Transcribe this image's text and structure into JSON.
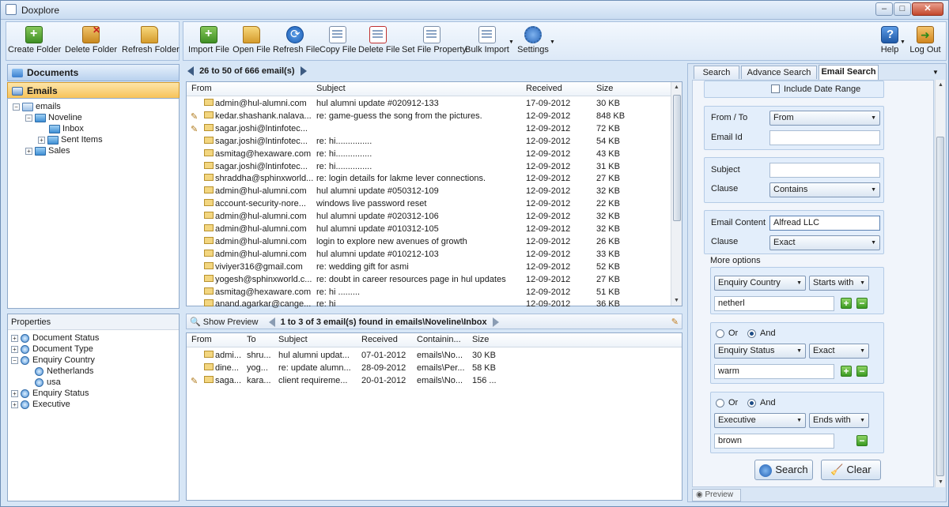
{
  "window": {
    "title": "Doxplore",
    "min": "–",
    "max": "□",
    "close": "✕"
  },
  "left_toolbar": [
    {
      "label": "Create Folder",
      "icon": "create-folder-icon"
    },
    {
      "label": "Delete Folder",
      "icon": "delete-folder-icon"
    },
    {
      "label": "Refresh Folder",
      "icon": "refresh-folder-icon"
    }
  ],
  "main_toolbar": [
    {
      "label": "Import File",
      "icon": "import-file-icon"
    },
    {
      "label": "Open File",
      "icon": "open-file-icon"
    },
    {
      "label": "Refresh File",
      "icon": "refresh-file-icon"
    },
    {
      "label": "Copy File",
      "icon": "copy-file-icon"
    },
    {
      "label": "Delete File",
      "icon": "delete-file-icon"
    },
    {
      "label": "Set File Property",
      "icon": "set-file-property-icon"
    },
    {
      "label": "Bulk Import",
      "icon": "bulk-import-icon"
    },
    {
      "label": "Settings",
      "icon": "settings-icon"
    }
  ],
  "right_toolbar": [
    {
      "label": "Help",
      "icon": "help-icon"
    },
    {
      "label": "Log Out",
      "icon": "log-out-icon"
    }
  ],
  "nav": {
    "documents": "Documents",
    "emails": "Emails"
  },
  "tree": {
    "root": "emails",
    "noveline": "Noveline",
    "inbox": "Inbox",
    "sent": "Sent Items",
    "sales": "Sales"
  },
  "properties": {
    "title": "Properties",
    "items": [
      "Document Status",
      "Document Type",
      "Enquiry Country",
      "Netherlands",
      "usa",
      "Enquiry Status",
      "Executive"
    ]
  },
  "email_list": {
    "pager": "26 to 50 of 666 email(s)",
    "columns": [
      "From",
      "Subject",
      "Received",
      "Size"
    ],
    "rows": [
      {
        "from": "admin@hul-alumni.com",
        "subject": "hul alumni update #020912-133",
        "received": "17-09-2012",
        "size": "30 KB",
        "attach": false
      },
      {
        "from": "kedar.shashank.nalava...",
        "subject": "re: game-guess the song from the pictures.",
        "received": "12-09-2012",
        "size": "848 KB",
        "attach": true
      },
      {
        "from": "sagar.joshi@lntinfotec...",
        "subject": "",
        "received": "12-09-2012",
        "size": "72 KB",
        "attach": true
      },
      {
        "from": "sagar.joshi@lntinfotec...",
        "subject": "re: hi...............",
        "received": "12-09-2012",
        "size": "54 KB",
        "attach": false
      },
      {
        "from": "asmitag@hexaware.com",
        "subject": "re: hi...............",
        "received": "12-09-2012",
        "size": "43 KB",
        "attach": false
      },
      {
        "from": "sagar.joshi@lntinfotec...",
        "subject": "re: hi...............",
        "received": "12-09-2012",
        "size": "31 KB",
        "attach": false
      },
      {
        "from": "shraddha@sphinxworld...",
        "subject": "re: login details for lakme lever connections.",
        "received": "12-09-2012",
        "size": "27 KB",
        "attach": false
      },
      {
        "from": "admin@hul-alumni.com",
        "subject": "hul alumni update #050312-109",
        "received": "12-09-2012",
        "size": "32 KB",
        "attach": false
      },
      {
        "from": "account-security-nore...",
        "subject": "windows live password reset",
        "received": "12-09-2012",
        "size": "22 KB",
        "attach": false
      },
      {
        "from": "admin@hul-alumni.com",
        "subject": "hul alumni update #020312-106",
        "received": "12-09-2012",
        "size": "32 KB",
        "attach": false
      },
      {
        "from": "admin@hul-alumni.com",
        "subject": "hul alumni update #010312-105",
        "received": "12-09-2012",
        "size": "32 KB",
        "attach": false
      },
      {
        "from": "admin@hul-alumni.com",
        "subject": "login to explore new avenues of growth",
        "received": "12-09-2012",
        "size": "26 KB",
        "attach": false
      },
      {
        "from": "admin@hul-alumni.com",
        "subject": "hul alumni update #010212-103",
        "received": "12-09-2012",
        "size": "33 KB",
        "attach": false
      },
      {
        "from": "viviyer316@gmail.com",
        "subject": "re: wedding gift for asmi",
        "received": "12-09-2012",
        "size": "52 KB",
        "attach": false
      },
      {
        "from": "yogesh@sphinxworld.c...",
        "subject": "re: doubt in career resources page in hul updates",
        "received": "12-09-2012",
        "size": "27 KB",
        "attach": false
      },
      {
        "from": "asmitag@hexaware.com",
        "subject": "re: hi .........",
        "received": "12-09-2012",
        "size": "51 KB",
        "attach": false
      },
      {
        "from": "anand.agarkar@cange...",
        "subject": "re: hi",
        "received": "12-09-2012",
        "size": "36 KB",
        "attach": false
      }
    ]
  },
  "result_list": {
    "show_preview": "Show Preview",
    "pager": "1 to 3 of 3 email(s) found in emails\\Noveline\\Inbox",
    "columns": [
      "From",
      "To",
      "Subject",
      "Received",
      "Containin...",
      "Size"
    ],
    "rows": [
      {
        "from": "admi...",
        "to": "shru...",
        "subject": "hul alumni updat...",
        "received": "07-01-2012",
        "container": "emails\\No...",
        "size": "30 KB",
        "attach": false
      },
      {
        "from": "dine...",
        "to": "yog...",
        "subject": "re: update alumn...",
        "received": "28-09-2012",
        "container": "emails\\Per...",
        "size": "58 KB",
        "attach": false
      },
      {
        "from": "saga...",
        "to": "kara...",
        "subject": "client requireme...",
        "received": "20-01-2012",
        "container": "emails\\No...",
        "size": "156 ...",
        "attach": true
      }
    ]
  },
  "search_panel": {
    "tabs": [
      "Search",
      "Advance Search",
      "Email Search"
    ],
    "active_tab": "Email Search",
    "include_date_range": "Include Date Range",
    "from_to_label": "From / To",
    "from_to_value": "From",
    "email_id_label": "Email Id",
    "email_id_value": "",
    "subject_label": "Subject",
    "subject_value": "",
    "clause_label": "Clause",
    "subject_clause": "Contains",
    "email_content_label": "Email Content",
    "email_content_value": "Alfread LLC",
    "content_clause": "Exact",
    "more_options": "More options",
    "opt1": {
      "field": "Enquiry Country",
      "op": "Starts with",
      "value": "netherl"
    },
    "or_label": "Or",
    "and_label": "And",
    "opt2": {
      "field": "Enquiry Status",
      "op": "Exact",
      "value": "warm"
    },
    "opt3": {
      "field": "Executive",
      "op": "Ends with",
      "value": "brown"
    },
    "search_btn": "Search",
    "clear_btn": "Clear",
    "preview_tab": "Preview"
  }
}
